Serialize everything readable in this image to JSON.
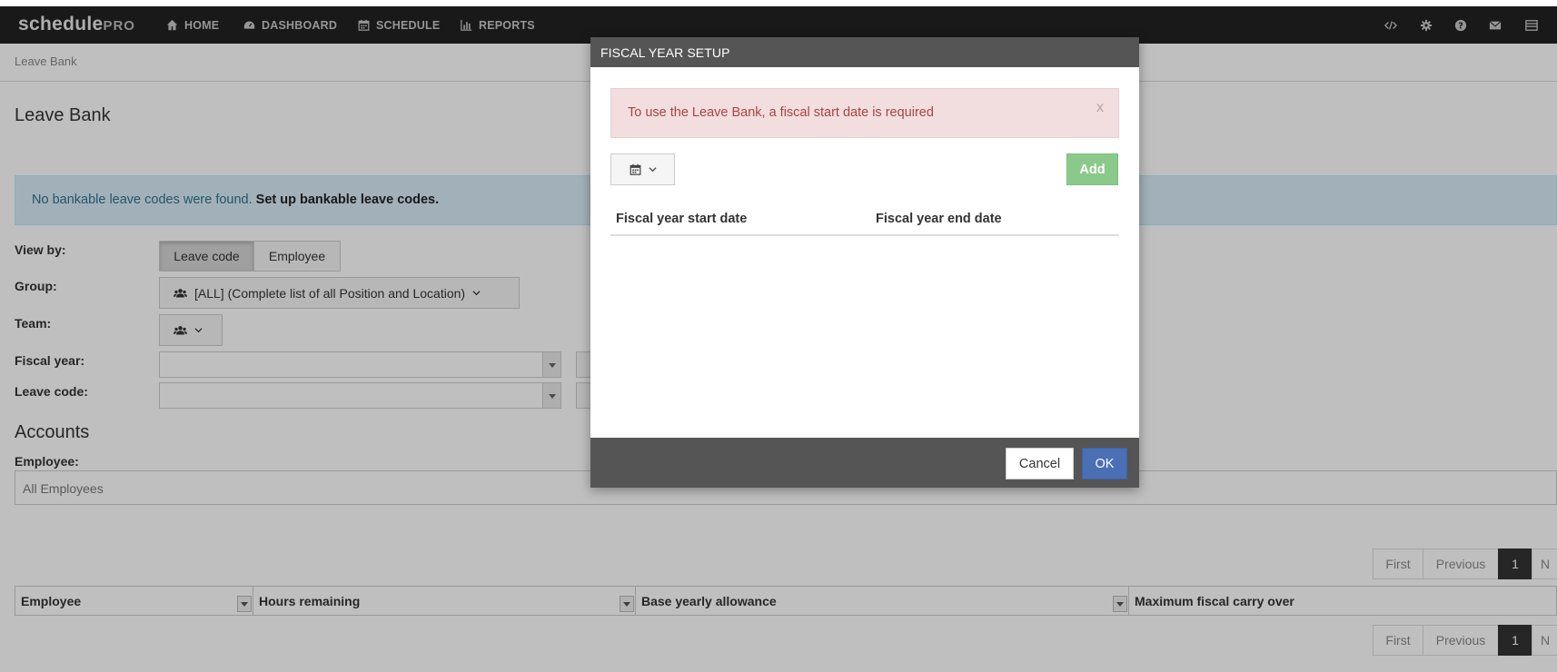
{
  "brand": {
    "name": "schedule",
    "suffix": "PRO"
  },
  "nav": {
    "items": [
      {
        "label": "HOME",
        "icon": "home-icon"
      },
      {
        "label": "DASHBOARD",
        "icon": "dashboard-icon"
      },
      {
        "label": "SCHEDULE",
        "icon": "calendar-icon"
      },
      {
        "label": "REPORTS",
        "icon": "bar-chart-icon"
      }
    ],
    "right_icons": [
      "code-icon",
      "gear-icon",
      "help-icon",
      "envelope-icon",
      "menu-icon"
    ]
  },
  "breadcrumb": "Leave Bank",
  "page": {
    "title": "Leave Bank",
    "info_alert": {
      "text": "No bankable leave codes were found. ",
      "link": "Set up bankable leave codes."
    },
    "view_by": {
      "label": "View by:",
      "options": [
        "Leave code",
        "Employee"
      ],
      "selected": "Leave code"
    },
    "group": {
      "label": "Group:",
      "value": "[ALL] (Complete list of all Position and Location)"
    },
    "team": {
      "label": "Team:"
    },
    "fiscal_year": {
      "label": "Fiscal year:",
      "value": ""
    },
    "leave_code": {
      "label": "Leave code:",
      "value": ""
    },
    "accounts_heading": "Accounts",
    "employee": {
      "label": "Employee:",
      "placeholder": "All Employees"
    },
    "pager": {
      "first": "First",
      "previous": "Previous",
      "current": "1",
      "next": "N"
    },
    "grid_columns": [
      "Employee",
      "Hours remaining",
      "Base yearly allowance",
      "Maximum fiscal carry over"
    ]
  },
  "modal": {
    "title": "FISCAL YEAR SETUP",
    "alert": "To use the Leave Bank, a fiscal start date is required",
    "alert_close": "x",
    "add_label": "Add",
    "columns": [
      "Fiscal year start date",
      "Fiscal year end date"
    ],
    "cancel_label": "Cancel",
    "ok_label": "OK"
  }
}
